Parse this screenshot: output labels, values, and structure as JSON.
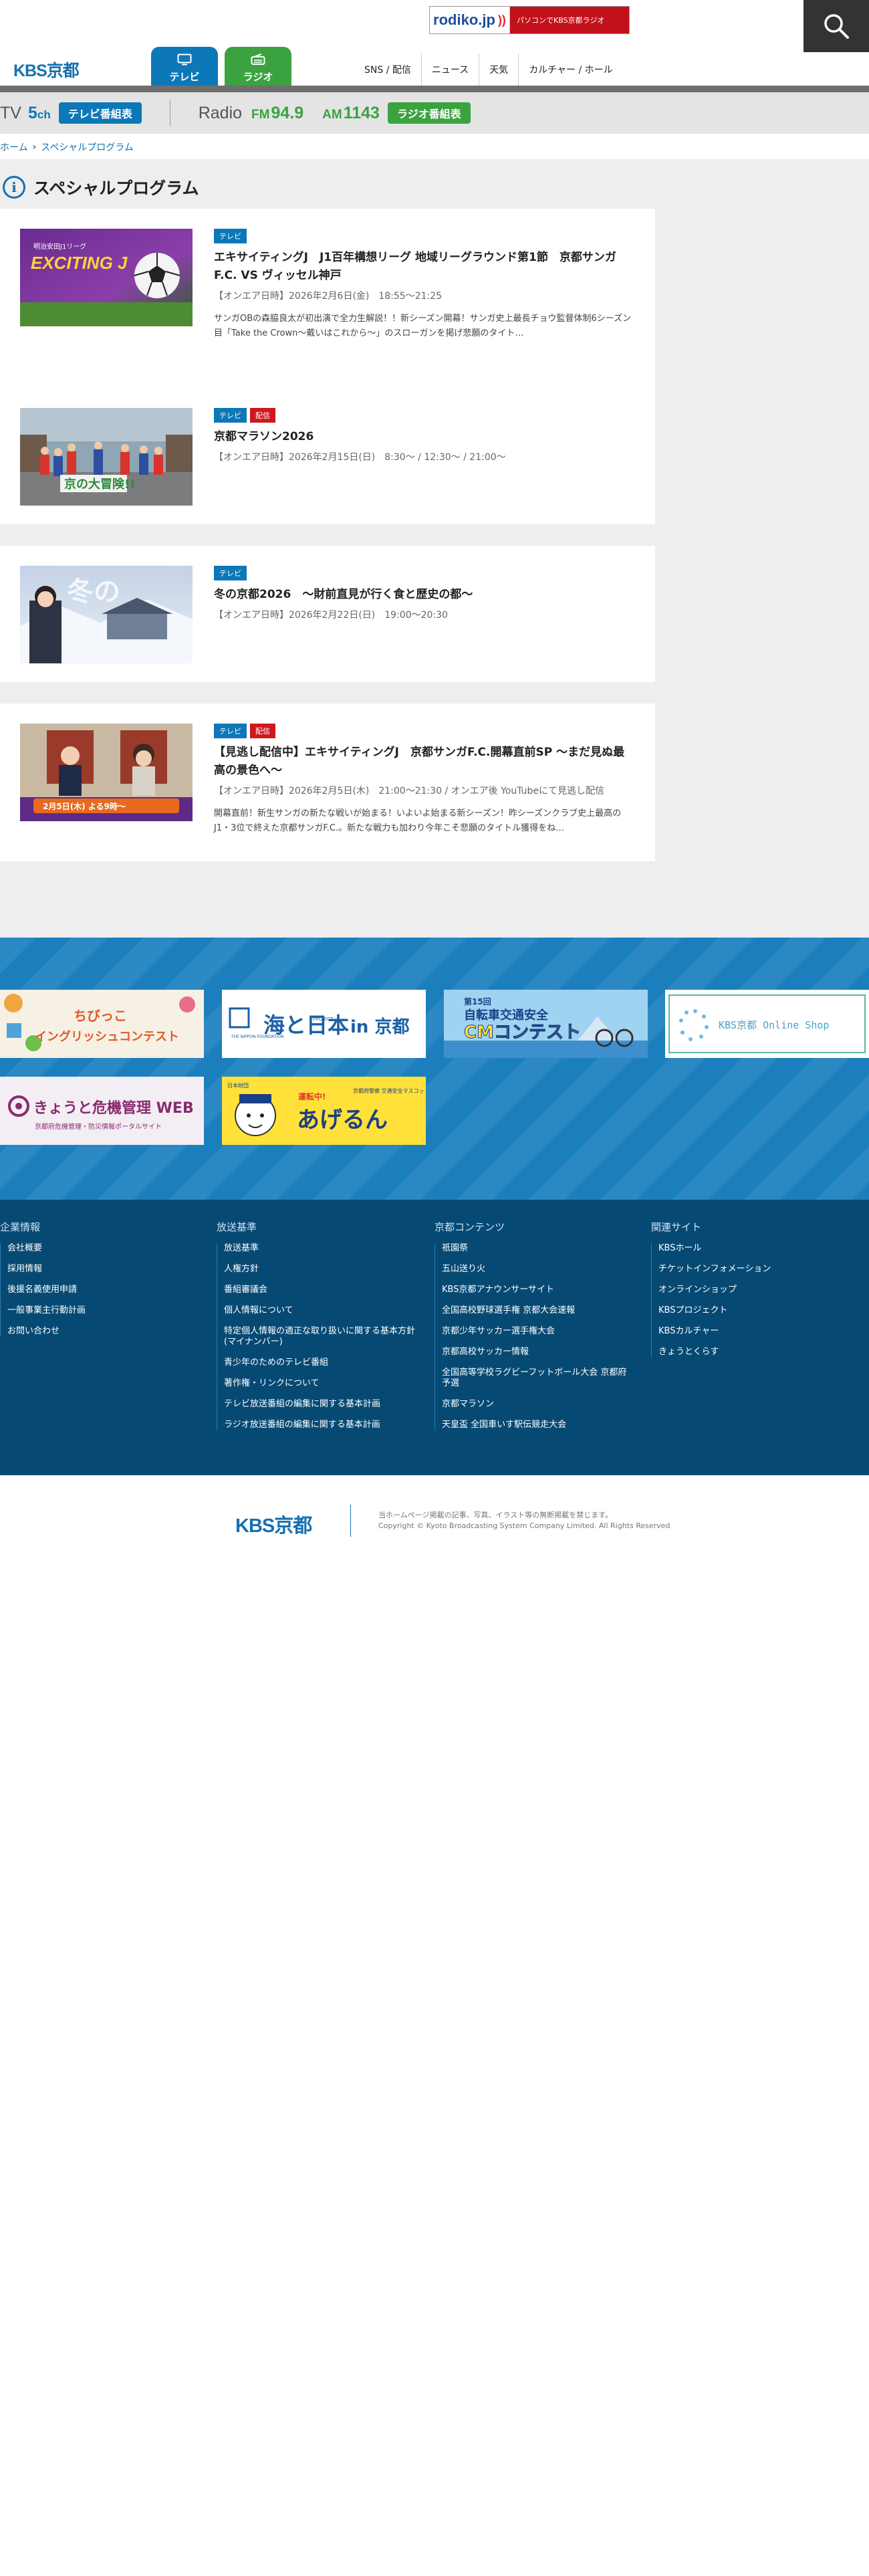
{
  "header": {
    "radiko_logo": "rodiko.jp",
    "radiko_text": "パソコンでKBS京都ラジオ",
    "site_logo": "KBS京都",
    "tabs": [
      {
        "label": "テレビ",
        "icon": "tv-icon"
      },
      {
        "label": "ラジオ",
        "icon": "radio-icon"
      }
    ],
    "nav": [
      "SNS / 配信",
      "ニュース",
      "天気",
      "カルチャー / ホール"
    ]
  },
  "channel_bar": {
    "tv_label": "TV",
    "tv_channel": "5",
    "tv_channel_unit": "ch",
    "tv_button": "テレビ番組表",
    "radio_label": "Radio",
    "fm_prefix": "FM",
    "fm_freq": "94.9",
    "am_prefix": "AM",
    "am_freq": "1143",
    "radio_button": "ラジオ番組表",
    "colors": {
      "tv": "#0c78b8",
      "radio": "#3aa33f"
    }
  },
  "breadcrumb": {
    "home": "ホーム",
    "current": "スペシャルプログラム"
  },
  "page": {
    "title": "スペシャルプログラム"
  },
  "programs": [
    {
      "badges": [
        "テレビ"
      ],
      "title": "エキサイティングJ　J1百年構想リーグ 地域リーグラウンド第1節　京都サンガF.C. VS ヴィッセル神戸",
      "date": "【オンエア日時】2026年2月6日(金)　18:55〜21:25",
      "desc": "サンガOBの森脇良太が初出演で全力生解説！！新シーズン開幕！サンガ史上最長チョウ監督体制6シーズン目「Take the Crown〜戴いはこれから〜」のスローガンを掲げ悲願のタイト…"
    },
    {
      "badges": [
        "テレビ",
        "配信"
      ],
      "title": "京都マラソン2026",
      "date": "【オンエア日時】2026年2月15日(日)　8:30〜 / 12:30〜 / 21:00〜",
      "desc": ""
    },
    {
      "badges": [
        "テレビ"
      ],
      "title": "冬の京都2026　〜財前直見が行く食と歴史の都〜",
      "date": "【オンエア日時】2026年2月22日(日)　19:00〜20:30",
      "desc": ""
    },
    {
      "badges": [
        "テレビ",
        "配信"
      ],
      "title": "【見逃し配信中】エキサイティングJ　京都サンガF.C.開幕直前SP 〜まだ見ぬ最高の景色へ〜",
      "date": "【オンエア日時】2026年2月5日(木)　21:00〜21:30 / オンエア後 YouTubeにて見逃し配信",
      "desc": "開幕直前！新生サンガの新たな戦いが始まる！いよいよ始まる新シーズン！昨シーズンクラブ史上最高のJ1・3位で終えた京都サンガF.C.。新たな戦力も加わり今年こそ悲願のタイトル獲得をね…"
    }
  ],
  "thumbs": {
    "t1_title": "EXCITING J",
    "t1_sub": "明治安田J1リーグ",
    "t2_title": "京の大冒険!!",
    "t3_title": "冬の",
    "t4_caption": "2月5日(木) よる9時〜"
  },
  "banners": [
    {
      "title": "ちびっこ",
      "sub": "イングリッシュコンテスト"
    },
    {
      "title": "海と日本",
      "mid": "PROJECT",
      "suffix": "in 京都",
      "org": "THE NIPPON FOUNDATION"
    },
    {
      "title": "第15回",
      "mid": "自転車交通安全",
      "sub": "CMコンテスト"
    },
    {
      "title": "KBS京都 Online Shop"
    },
    {
      "title": "きょうと危機管理 WEB",
      "sub": "京都府危機管理・防災情報ポータルサイト"
    },
    {
      "title": "あげるん",
      "pre": "運転中!",
      "sub": "京都府警察 交通安全マスコット",
      "org": "日本財団"
    }
  ],
  "footer": {
    "columns": [
      {
        "title": "企業情報",
        "items": [
          "会社概要",
          "採用情報",
          "後援名義使用申請",
          "一般事業主行動計画",
          "お問い合わせ"
        ]
      },
      {
        "title": "放送基準",
        "items": [
          "放送基準",
          "人権方針",
          "番組審議会",
          "個人情報について",
          "特定個人情報の適正な取り扱いに関する基本方針(マイナンバー)",
          "青少年のためのテレビ番組",
          "著作権・リンクについて",
          "テレビ放送番組の編集に関する基本計画",
          "ラジオ放送番組の編集に関する基本計画"
        ]
      },
      {
        "title": "京都コンテンツ",
        "items": [
          "祇園祭",
          "五山送り火",
          "KBS京都アナウンサーサイト",
          "全国高校野球選手権 京都大会速報",
          "京都少年サッカー選手権大会",
          "京都高校サッカー情報",
          "全国高等学校ラグビーフットボール大会 京都府予選",
          "京都マラソン",
          "天皇盃 全国車いす駅伝競走大会"
        ]
      },
      {
        "title": "関連サイト",
        "items": [
          "KBSホール",
          "チケットインフォメーション",
          "オンラインショップ",
          "KBSプロジェクト",
          "KBSカルチャー",
          "きょうとくらす"
        ]
      }
    ],
    "logo": "KBS京都",
    "notice": "当ホームページ掲載の記事、写真、イラスト等の無断掲載を禁じます。",
    "copyright": "Copyright © Kyoto Broadcasting System Company Limited. All Rights Reserved"
  }
}
